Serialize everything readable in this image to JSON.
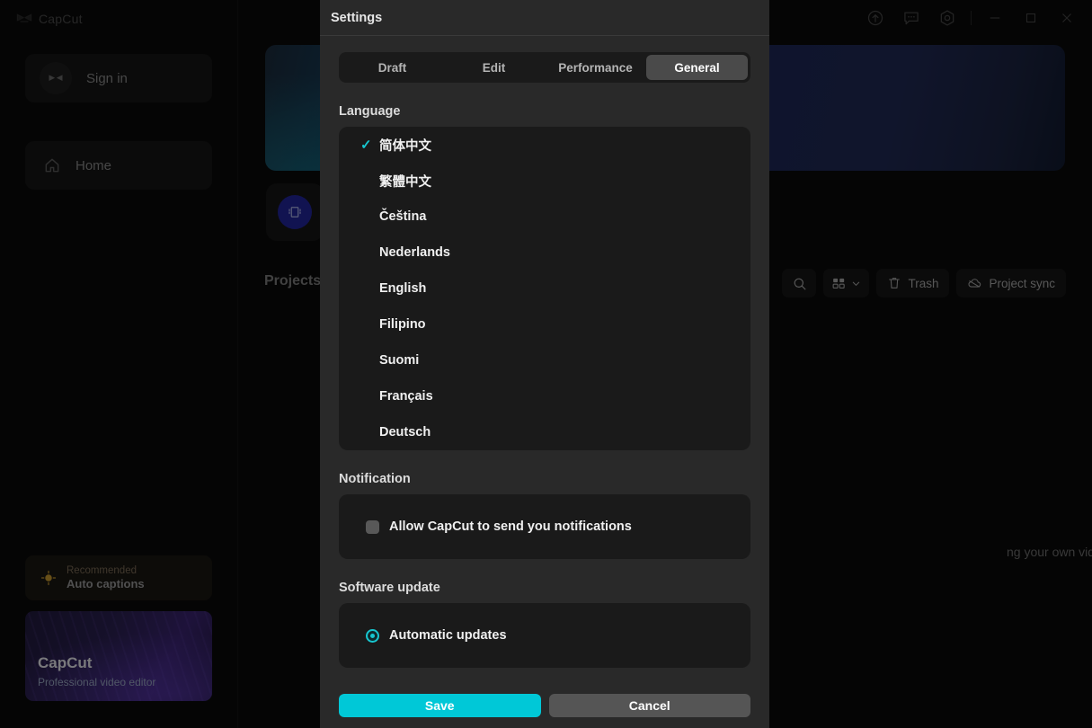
{
  "app": {
    "brand": "CapCut",
    "sidebar": {
      "signin_label": "Sign in",
      "home_label": "Home",
      "promo_recommended_eyebrow": "Recommended",
      "promo_recommended_title": "Auto captions",
      "promo_card_title": "CapCut",
      "promo_card_subtitle": "Professional video editor"
    },
    "main": {
      "projects_label": "Projects",
      "background_tip": "ng your own videos!",
      "toolbar": {
        "trash_label": "Trash",
        "project_sync_label": "Project sync"
      }
    },
    "window_controls": {
      "update_icon": "upload-arrow-icon",
      "feedback_icon": "feedback-chat-icon",
      "settings_icon": "gear-hexagon-icon",
      "minimize_icon": "minimize-icon",
      "maximize_icon": "maximize-icon",
      "close_icon": "close-icon"
    }
  },
  "modal": {
    "title": "Settings",
    "tabs": [
      {
        "label": "Draft",
        "active": false
      },
      {
        "label": "Edit",
        "active": false
      },
      {
        "label": "Performance",
        "active": false
      },
      {
        "label": "General",
        "active": true
      }
    ],
    "language": {
      "section_label": "Language",
      "selected": "简体中文",
      "items": [
        {
          "label": "简体中文",
          "selected": true
        },
        {
          "label": "繁體中文",
          "selected": false
        },
        {
          "label": "Čeština",
          "selected": false
        },
        {
          "label": "Nederlands",
          "selected": false
        },
        {
          "label": "English",
          "selected": false
        },
        {
          "label": "Filipino",
          "selected": false
        },
        {
          "label": "Suomi",
          "selected": false
        },
        {
          "label": "Français",
          "selected": false
        },
        {
          "label": "Deutsch",
          "selected": false
        }
      ]
    },
    "notification": {
      "section_label": "Notification",
      "checkbox_label": "Allow CapCut to send you notifications",
      "checked": false
    },
    "software_update": {
      "section_label": "Software update",
      "option_label": "Automatic updates",
      "selected": true
    },
    "footer": {
      "save_label": "Save",
      "cancel_label": "Cancel"
    },
    "colors": {
      "accent": "#00c8d7",
      "check": "#17c6cf",
      "panel": "#292929",
      "card": "#1a1a1a",
      "tab_active": "#4a4a4a",
      "cancel": "#555555"
    }
  }
}
